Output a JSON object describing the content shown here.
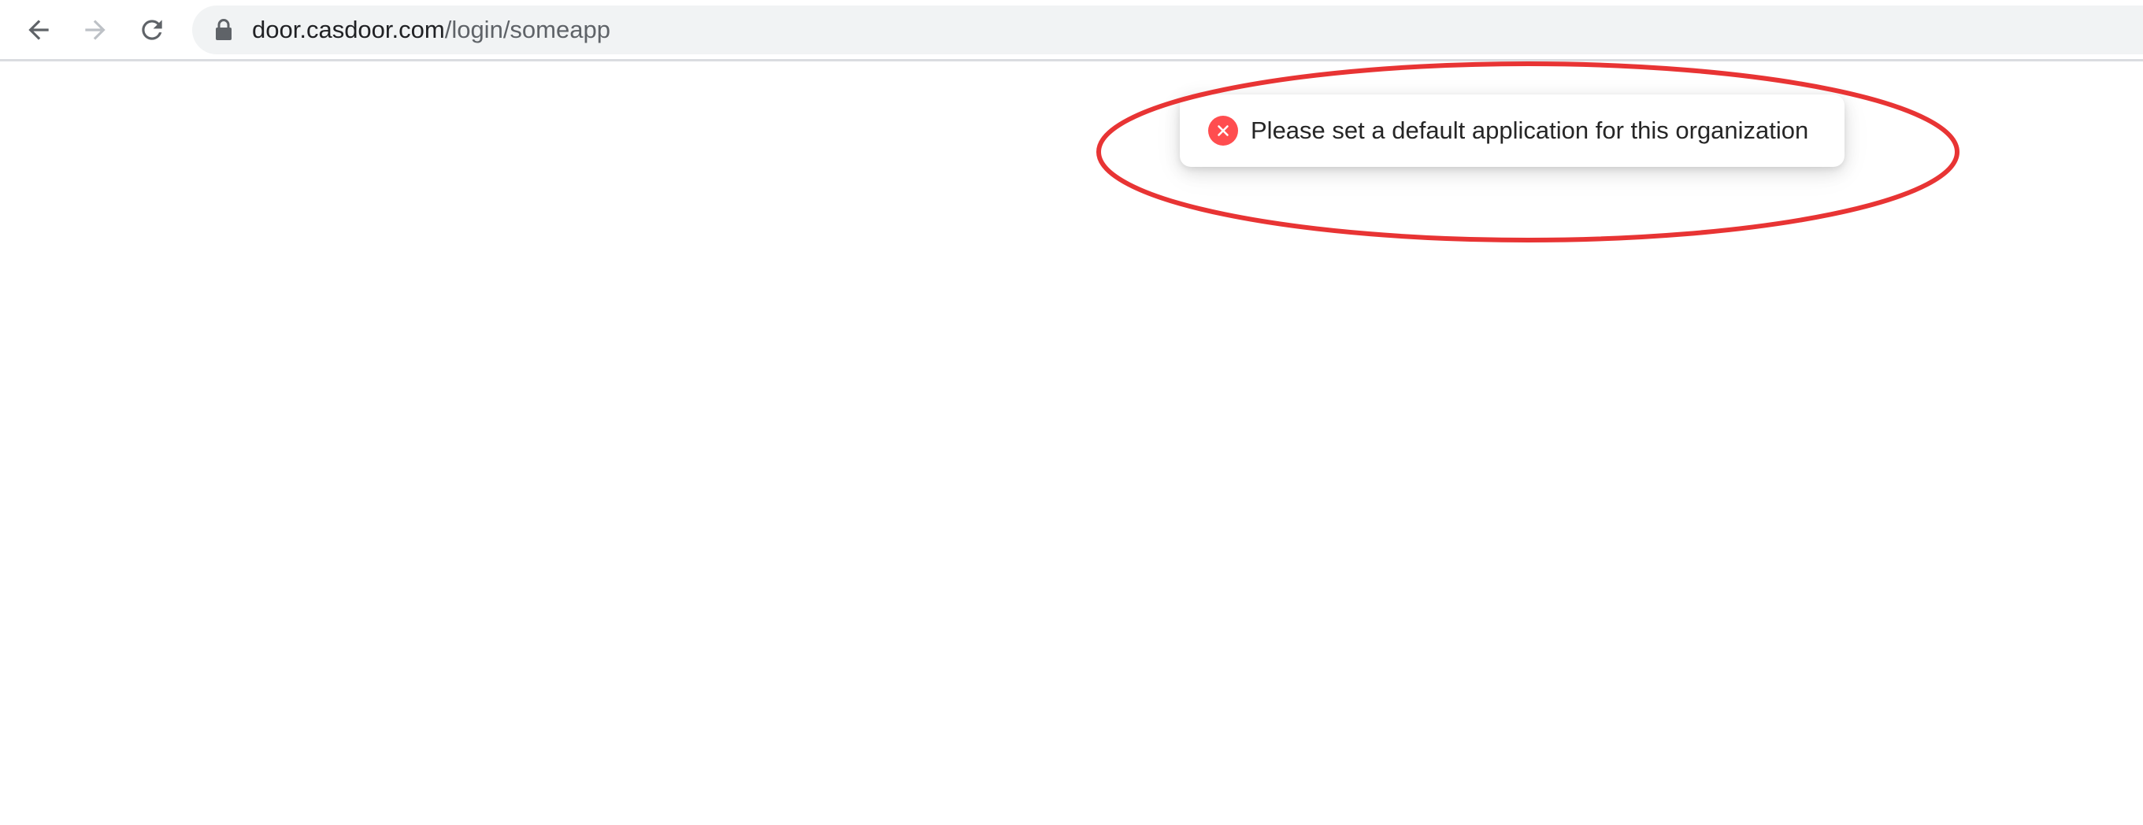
{
  "browser": {
    "url_host": "door.casdoor.com",
    "url_path": "/login/someapp",
    "icons": {
      "back": "arrow-left-icon",
      "forward": "arrow-right-icon",
      "reload": "reload-icon",
      "lock": "lock-icon"
    },
    "colors": {
      "omnibox_bg": "#f1f3f4",
      "icon_active": "#5f6368",
      "icon_disabled": "#bdc1c6"
    }
  },
  "toast": {
    "message": "Please set a default application for this organization",
    "type": "error",
    "icon": "error-circle-icon",
    "icon_color": "#ff4d4f"
  },
  "annotation": {
    "shape": "ellipse",
    "color": "#e83434"
  }
}
